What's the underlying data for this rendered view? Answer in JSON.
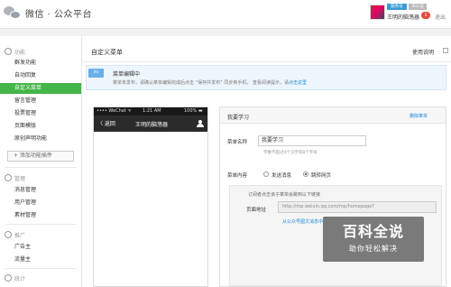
{
  "header": {
    "brand": "微信 · 公众平台",
    "user_tag": "服务号",
    "verify_tag": "未认证",
    "user_name": "王明的脑荡器",
    "msg_count": "1",
    "logout": "退出"
  },
  "sidebar": {
    "sections": [
      {
        "label": "功能",
        "icon": "function-icon"
      },
      {
        "label": "管理",
        "icon": "manage-icon"
      },
      {
        "label": "推广",
        "icon": "promote-icon"
      },
      {
        "label": "统计",
        "icon": "stats-icon"
      }
    ],
    "function_items": [
      "群发功能",
      "自动回复",
      "自定义菜单",
      "留言管理",
      "投票管理",
      "页面模版",
      "原创声明功能"
    ],
    "add_plugin": "+ 添加功能插件",
    "manage_items": [
      "消息管理",
      "用户管理",
      "素材管理"
    ],
    "promote_items": [
      "广告主",
      "流量主"
    ]
  },
  "main": {
    "title": "自定义菜单",
    "help": "使用说明",
    "notice": {
      "badge": "ifo",
      "title": "菜单编辑中",
      "desc": "菜单未发布，请确认菜单编辑完成后点击 “保存并发布” 同步到手机。 查看阅读提示，请",
      "link": "点击这里"
    }
  },
  "phone": {
    "carrier": "•••• WeChat ᯤ",
    "time": "1:21 AM",
    "battery": "100% ▬",
    "back": "〈 返回",
    "account_name": "王明的脑荡器"
  },
  "editor": {
    "menu_title": "我要学习",
    "delete": "删除菜单",
    "name_label": "菜单名称",
    "name_value": "我要学习",
    "hint": "字数不超过4个汉字或8个字母",
    "content_label": "菜单内容",
    "option_send": "发送消息",
    "option_jump": "跳转网页",
    "jump_desc": "订阅者点击该子菜单会跳到以下链接",
    "page_label": "页面地址",
    "url": "http://mp.weixin.qq.com/mp/homepage?",
    "from_link": "从公众号图文消息中"
  },
  "watermark": {
    "title": "百科全说",
    "subtitle": "助你轻松解决"
  },
  "colors": {
    "accent": "#44b549",
    "link": "#1b8ad9",
    "badge": "#e14b3b"
  }
}
